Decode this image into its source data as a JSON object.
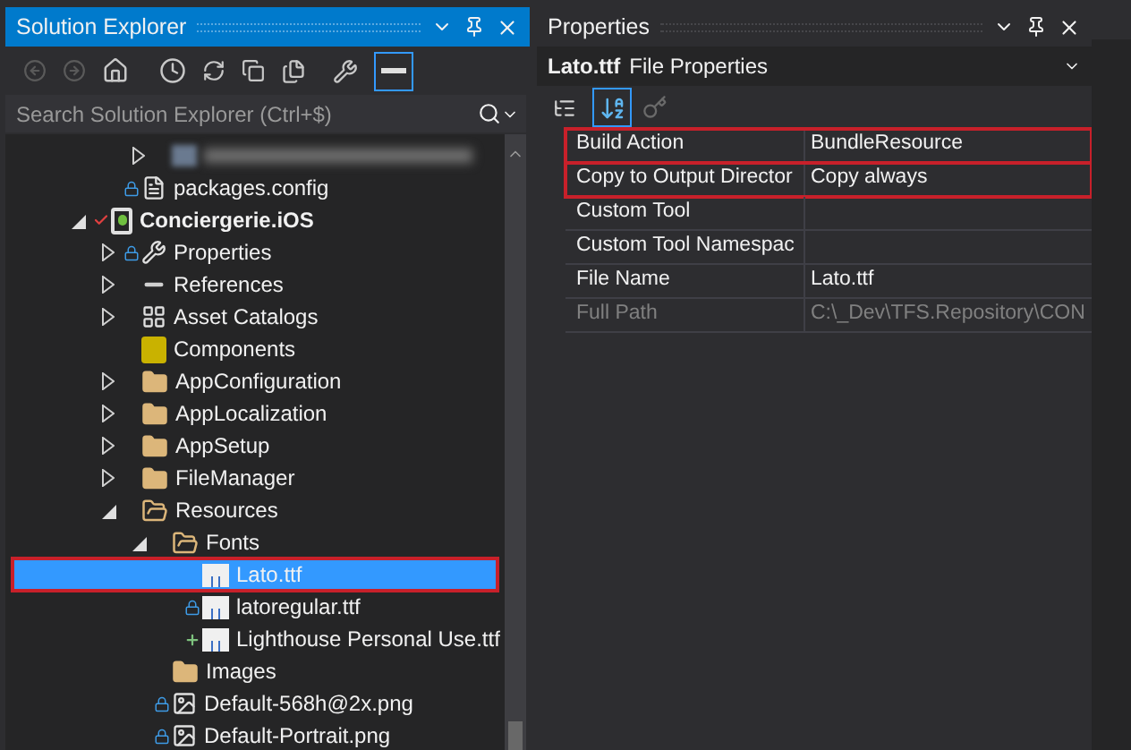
{
  "solution_explorer": {
    "title": "Solution Explorer",
    "search": {
      "placeholder": "Search Solution Explorer (Ctrl+$)"
    },
    "tree": [
      {
        "kind": "offscreen",
        "children": [
          {
            "kind": "offscreen",
            "children": [
              {
                "kind": "blurred",
                "expanded": false,
                "selected": false,
                "highlighted": false
              }
            ]
          },
          {
            "kind": "config",
            "label": "packages.config",
            "locked": true,
            "selected": false,
            "highlighted": false
          }
        ]
      },
      {
        "kind": "project",
        "label": "Conciergerie.iOS",
        "checked_out": true,
        "expanded": true,
        "selected": false,
        "highlighted": false,
        "children": [
          {
            "kind": "properties",
            "label": "Properties",
            "locked": true,
            "expanded": false,
            "selected": false,
            "highlighted": false
          },
          {
            "kind": "references",
            "label": "References",
            "expanded": false,
            "selected": false,
            "highlighted": false
          },
          {
            "kind": "assets",
            "label": "Asset Catalogs",
            "expanded": false,
            "selected": false,
            "highlighted": false
          },
          {
            "kind": "components",
            "label": "Components",
            "selected": false,
            "highlighted": false
          },
          {
            "kind": "folder",
            "label": "AppConfiguration",
            "expanded": false,
            "selected": false,
            "highlighted": false
          },
          {
            "kind": "folder",
            "label": "AppLocalization",
            "expanded": false,
            "selected": false,
            "highlighted": false
          },
          {
            "kind": "folder",
            "label": "AppSetup",
            "expanded": false,
            "selected": false,
            "highlighted": false
          },
          {
            "kind": "folder",
            "label": "FileManager",
            "expanded": false,
            "selected": false,
            "highlighted": false
          },
          {
            "kind": "folder",
            "label": "Resources",
            "expanded": true,
            "selected": false,
            "highlighted": false,
            "children": [
              {
                "kind": "folder",
                "label": "Fonts",
                "expanded": true,
                "selected": false,
                "highlighted": false,
                "children": [
                  {
                    "kind": "font",
                    "label": "Lato.ttf",
                    "selected": true,
                    "highlighted": true
                  },
                  {
                    "kind": "font",
                    "label": "latoregular.ttf",
                    "locked": true,
                    "selected": false,
                    "highlighted": false
                  },
                  {
                    "kind": "font",
                    "label": "Lighthouse Personal Use.ttf",
                    "added": true,
                    "selected": false,
                    "highlighted": false
                  }
                ]
              },
              {
                "kind": "folder",
                "label": "Images",
                "selected": false,
                "highlighted": false
              },
              {
                "kind": "image",
                "label": "Default-568h@2x.png",
                "locked": true,
                "selected": false,
                "highlighted": false
              },
              {
                "kind": "image",
                "label": "Default-Portrait.png",
                "locked": true,
                "selected": false,
                "highlighted": false
              }
            ]
          }
        ]
      }
    ]
  },
  "properties": {
    "title": "Properties",
    "object_name": "Lato.ttf",
    "object_type": "File Properties",
    "sort_alphabetical": true,
    "rows": [
      {
        "name": "Build Action",
        "value": "BundleResource",
        "disabled": false,
        "highlighted": true
      },
      {
        "name": "Copy to Output Director",
        "value": "Copy always",
        "disabled": false,
        "highlighted": true
      },
      {
        "name": "Custom Tool",
        "value": "",
        "disabled": false,
        "highlighted": false
      },
      {
        "name": "Custom Tool Namespac",
        "value": "",
        "disabled": false,
        "highlighted": false
      },
      {
        "name": "File Name",
        "value": "Lato.ttf",
        "disabled": false,
        "highlighted": false
      },
      {
        "name": "Full Path",
        "value": "C:\\_Dev\\TFS.Repository\\CON",
        "disabled": true,
        "highlighted": false
      }
    ]
  }
}
